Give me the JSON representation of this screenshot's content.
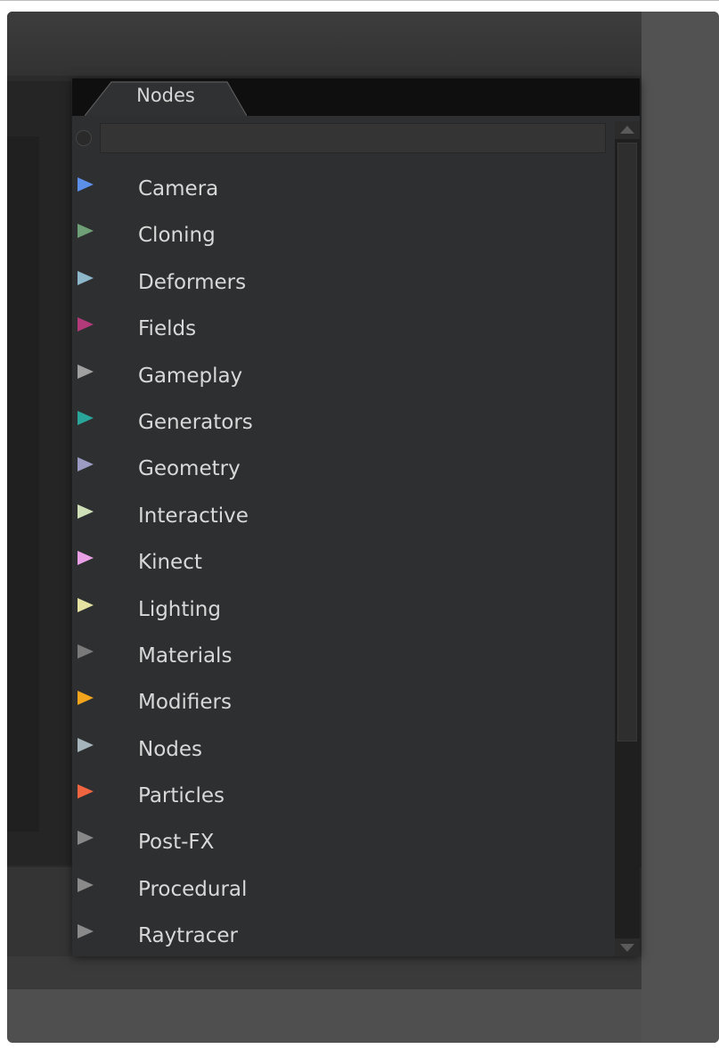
{
  "panel": {
    "tab_label": "Nodes",
    "search": {
      "value": "",
      "placeholder": ""
    },
    "items": [
      {
        "label": "Camera",
        "color": "#5b8fe8"
      },
      {
        "label": "Cloning",
        "color": "#6f9f76"
      },
      {
        "label": "Deformers",
        "color": "#8eb7cc"
      },
      {
        "label": "Fields",
        "color": "#b23a7a"
      },
      {
        "label": "Gameplay",
        "color": "#a0a0a0"
      },
      {
        "label": "Generators",
        "color": "#2aa59a"
      },
      {
        "label": "Geometry",
        "color": "#9b9bc4"
      },
      {
        "label": "Interactive",
        "color": "#cfe0b8"
      },
      {
        "label": "Kinect",
        "color": "#e9a0e6"
      },
      {
        "label": "Lighting",
        "color": "#e6e3a2"
      },
      {
        "label": "Materials",
        "color": "#7a7a7a"
      },
      {
        "label": "Modifiers",
        "color": "#f2a51c"
      },
      {
        "label": "Nodes",
        "color": "#a6b5bb"
      },
      {
        "label": "Particles",
        "color": "#ee6540"
      },
      {
        "label": "Post-FX",
        "color": "#888888"
      },
      {
        "label": "Procedural",
        "color": "#8a8a8a"
      },
      {
        "label": "Raytracer",
        "color": "#8a8a8a"
      }
    ]
  },
  "icons": {
    "item_arrow": "triangle-right-icon",
    "scroll_up": "arrow-up-icon",
    "scroll_down": "arrow-down-icon"
  }
}
